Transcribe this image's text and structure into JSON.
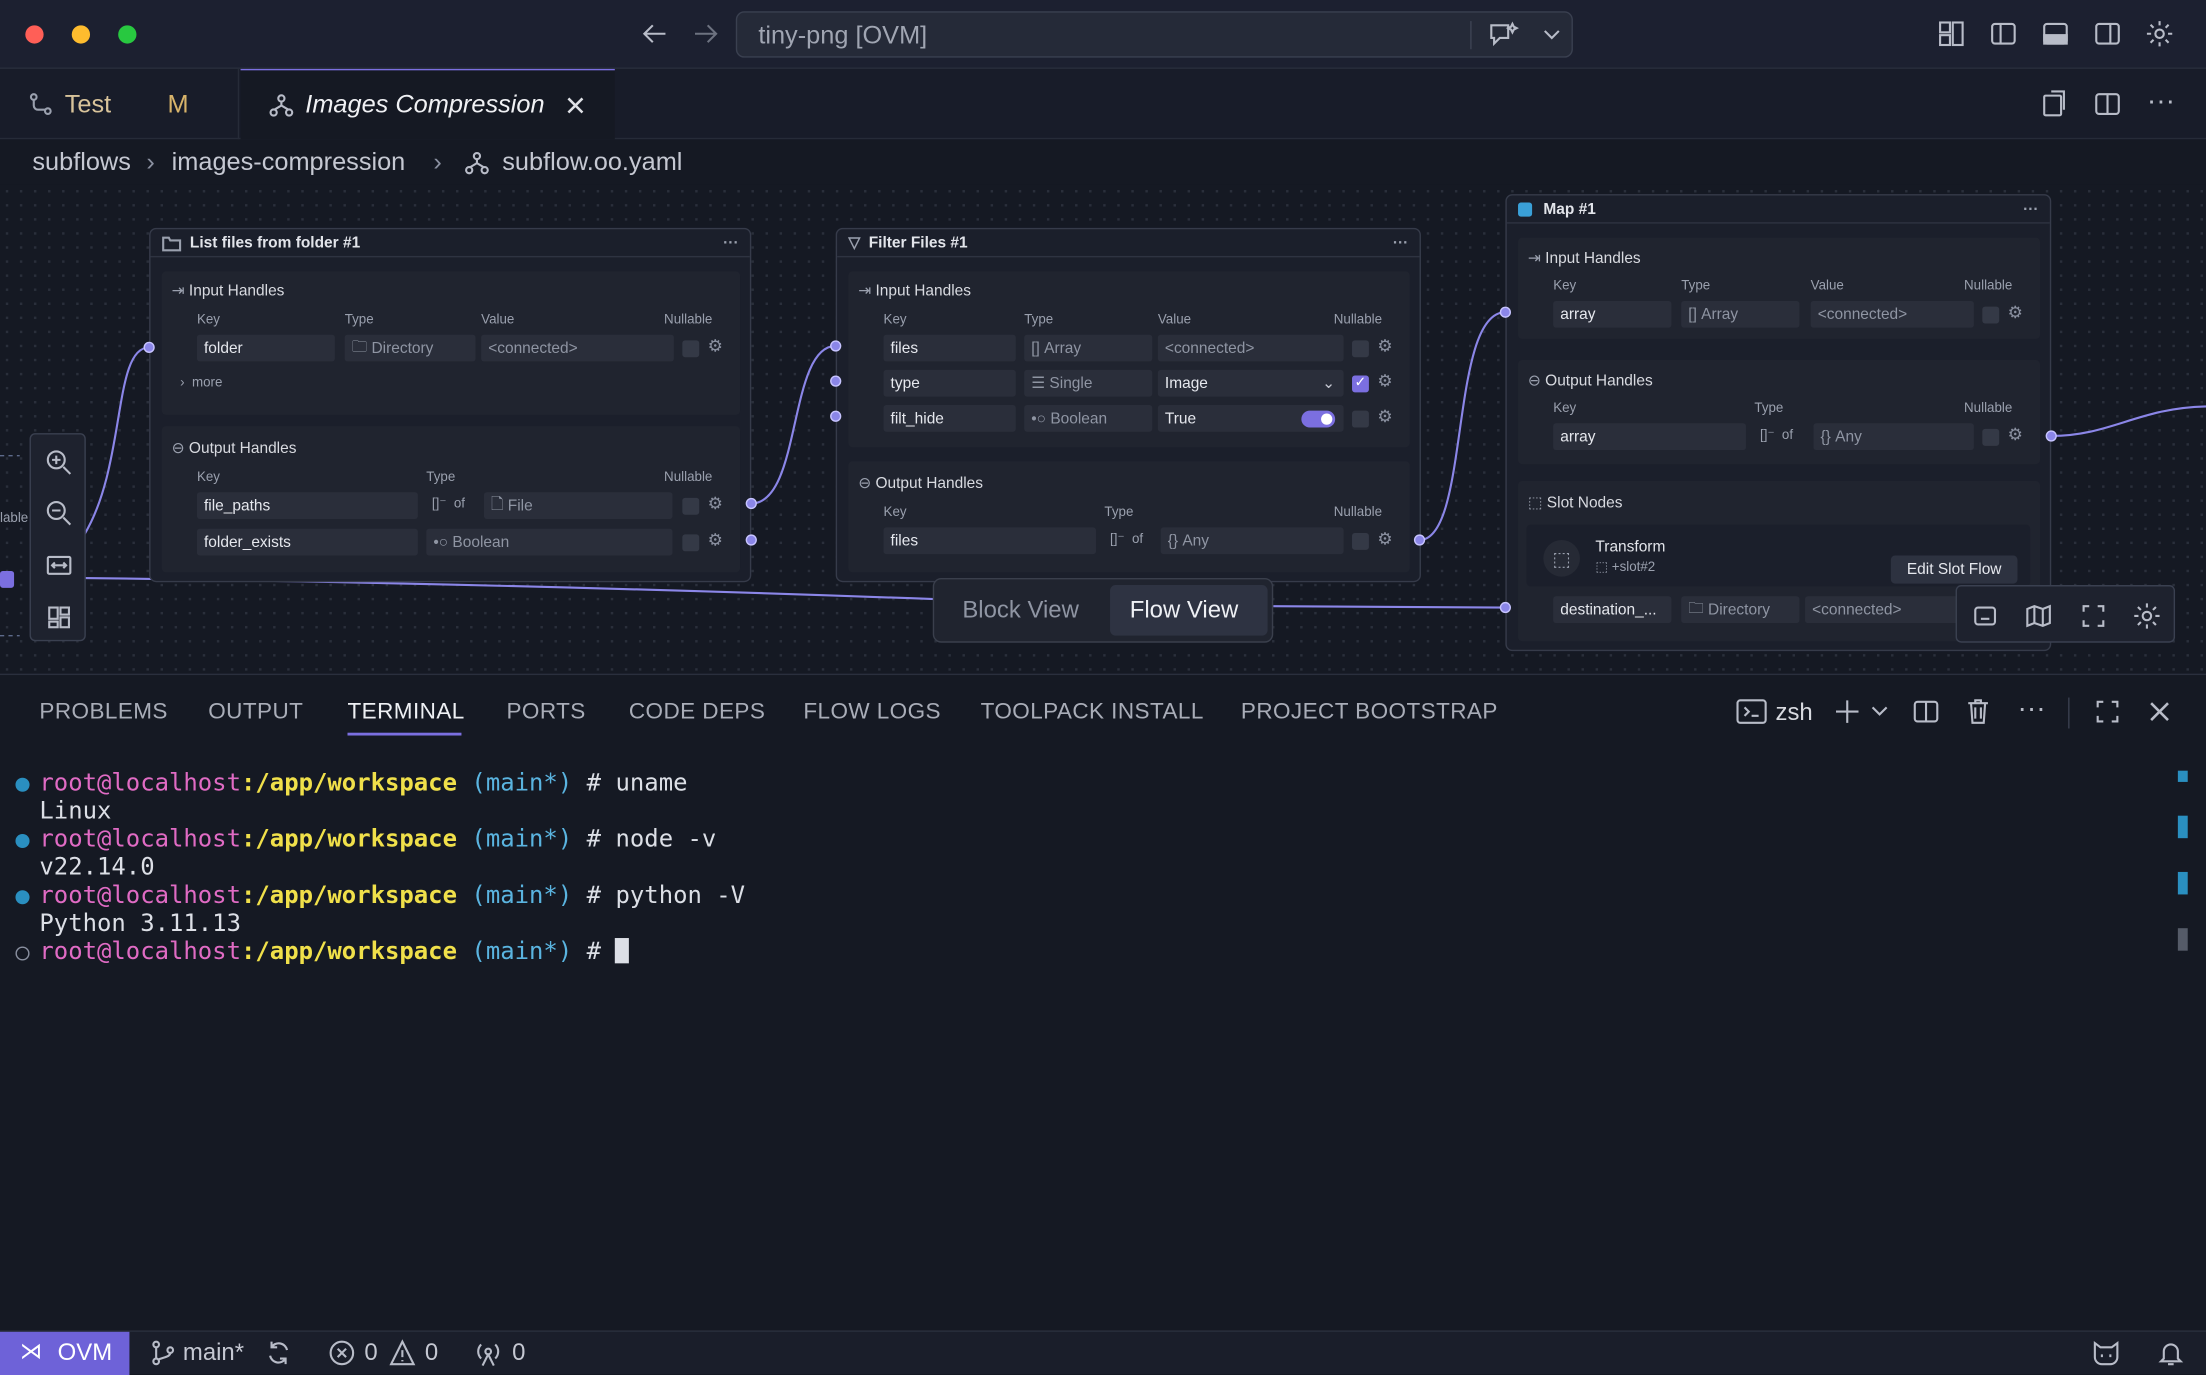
{
  "window": {
    "title": "tiny-png [OVM]"
  },
  "tabs": [
    {
      "label": "Test",
      "badge": "M"
    },
    {
      "label": "Images Compression"
    }
  ],
  "breadcrumb": [
    "subflows",
    "images-compression",
    "subflow.oo.yaml"
  ],
  "canvas": {
    "headers": {
      "key": "Key",
      "type": "Type",
      "value": "Value",
      "nullable": "Nullable"
    },
    "input_handles": "Input Handles",
    "output_handles": "Output Handles",
    "slot_nodes": "Slot Nodes",
    "more": "more",
    "of": "of",
    "nodes": {
      "list_files": {
        "title": "List files from folder #1",
        "inputs": [
          {
            "key": "folder",
            "type": "Directory",
            "value": "<connected>"
          }
        ],
        "outputs": [
          {
            "key": "file_paths",
            "type": "File"
          },
          {
            "key": "folder_exists",
            "type": "Boolean"
          }
        ]
      },
      "filter_files": {
        "title": "Filter Files #1",
        "inputs": [
          {
            "key": "files",
            "type": "Array",
            "value": "<connected>"
          },
          {
            "key": "type",
            "type": "Single",
            "value": "Image",
            "nullable": true
          },
          {
            "key": "filt_hide",
            "type": "Boolean",
            "value": "True",
            "toggle": true
          }
        ],
        "outputs": [
          {
            "key": "files",
            "type": "Any"
          }
        ]
      },
      "map": {
        "title": "Map #1",
        "inputs": [
          {
            "key": "array",
            "type": "Array",
            "value": "<connected>"
          }
        ],
        "outputs": [
          {
            "key": "array",
            "type": "Any"
          }
        ],
        "slot": {
          "name": "Transform",
          "sub": "+slot#2",
          "button": "Edit Slot Flow"
        },
        "slot_field": {
          "key": "destination_...",
          "type": "Directory",
          "value": "<connected>"
        }
      }
    },
    "left_partial": {
      "label": "lable"
    },
    "view_toggle": {
      "block": "Block View",
      "flow": "Flow View",
      "active": "Flow View"
    }
  },
  "panel": {
    "tabs": [
      "PROBLEMS",
      "OUTPUT",
      "TERMINAL",
      "PORTS",
      "CODE DEPS",
      "FLOW LOGS",
      "TOOLPACK INSTALL",
      "PROJECT BOOTSTRAP"
    ],
    "active": "TERMINAL",
    "shell": "zsh"
  },
  "terminal": {
    "prompt_user": "root@localhost",
    "prompt_path": ":/app/workspace",
    "prompt_branch": "(main*)",
    "prompt_hash": "#",
    "lines": [
      {
        "cmd": "uname",
        "out": "Linux"
      },
      {
        "cmd": "node -v",
        "out": "v22.14.0"
      },
      {
        "cmd": "python -V",
        "out": "Python 3.11.13"
      }
    ]
  },
  "status": {
    "remote": "OVM",
    "branch": "main*",
    "errors": "0",
    "warnings": "0",
    "ports": "0"
  },
  "colors": {
    "accent": "#7b6fe0",
    "canvas_bg": "#151923",
    "node_bg": "#1b1f2b",
    "edge": "#8b86e8"
  }
}
